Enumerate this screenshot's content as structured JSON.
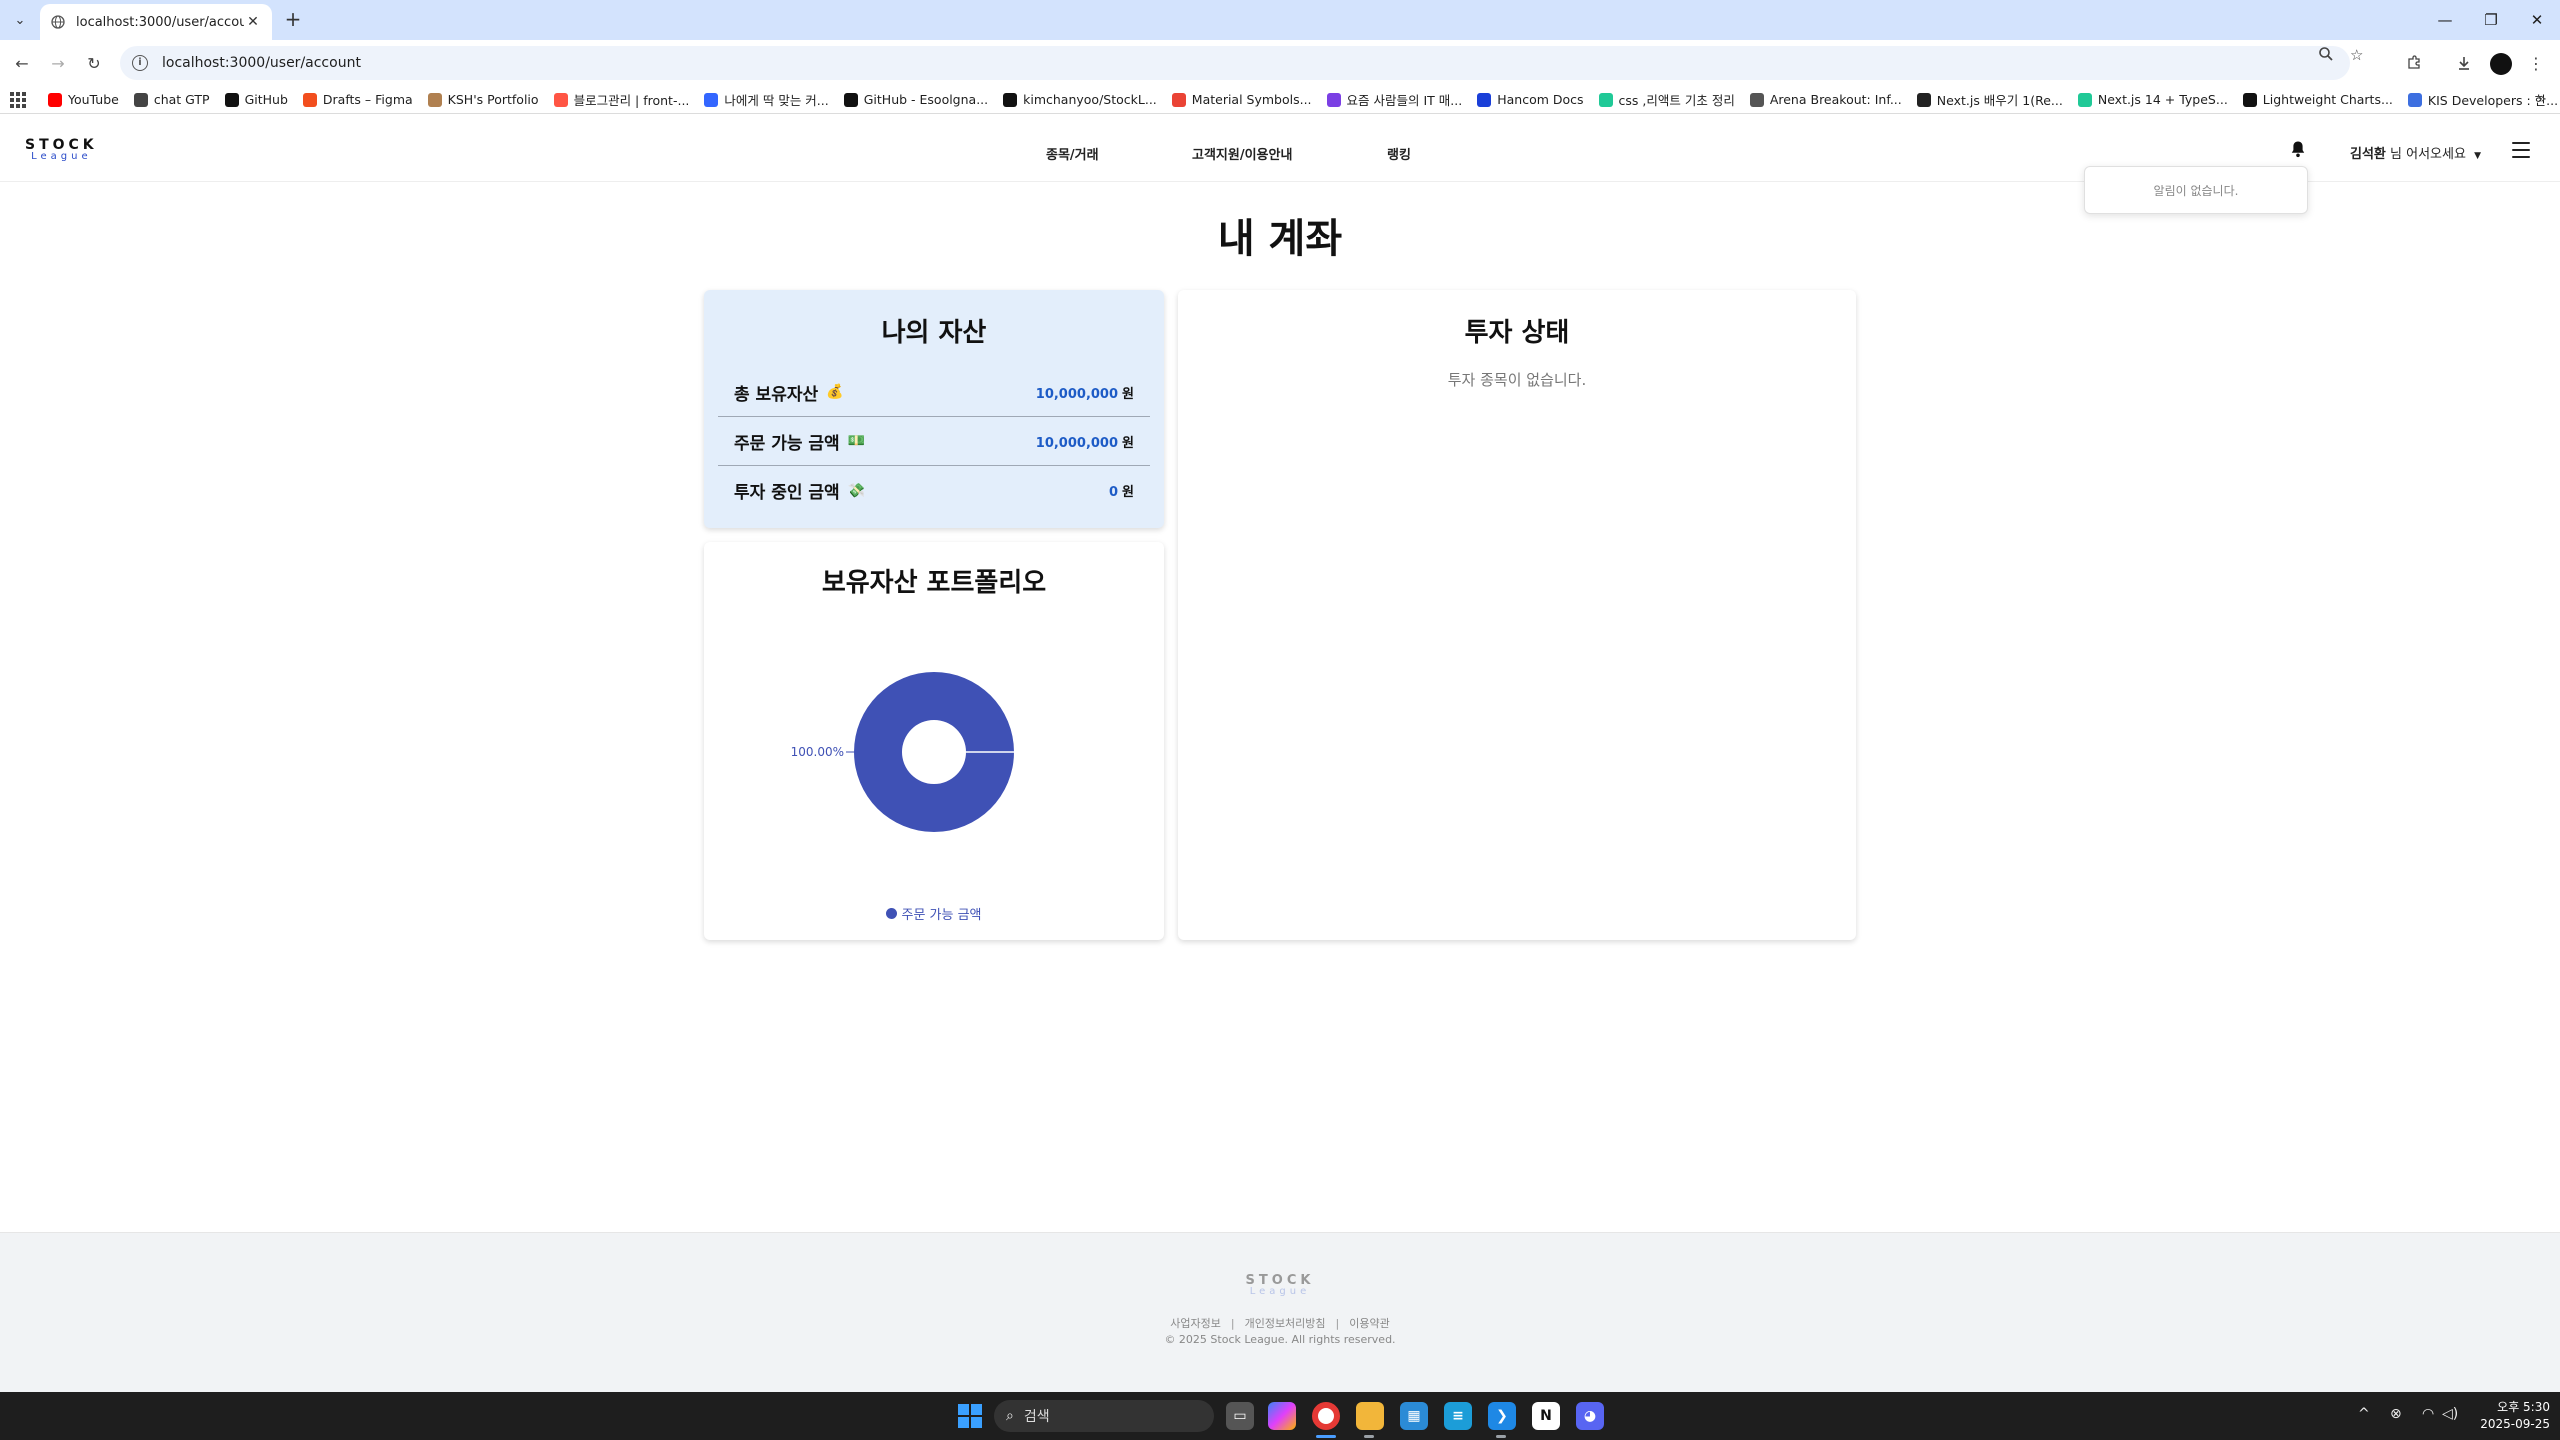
{
  "browser": {
    "tab_title": "localhost:3000/user/account",
    "url": "localhost:3000/user/account",
    "bookmarks": [
      {
        "label": "YouTube",
        "icon": "youtube-icon",
        "color": "#ff0000"
      },
      {
        "label": "chat GTP",
        "icon": "openai-icon",
        "color": "#444444"
      },
      {
        "label": "GitHub",
        "icon": "github-icon",
        "color": "#111111"
      },
      {
        "label": "Drafts – Figma",
        "icon": "figma-icon",
        "color": "#f24e1e"
      },
      {
        "label": "KSH's Portfolio",
        "icon": "portfolio-icon",
        "color": "#b08050"
      },
      {
        "label": "블로그관리 | front-...",
        "icon": "tistory-icon",
        "color": "#ff5544"
      },
      {
        "label": "나에게 딱 맞는 커...",
        "icon": "s-icon",
        "color": "#3366ff"
      },
      {
        "label": "GitHub - Esoolgna...",
        "icon": "github-icon",
        "color": "#111111"
      },
      {
        "label": "kimchanyoo/StockL...",
        "icon": "github-icon",
        "color": "#111111"
      },
      {
        "label": "Material Symbols...",
        "icon": "google-fonts-icon",
        "color": "#ea4335"
      },
      {
        "label": "요즘 사람들의 IT 매...",
        "icon": "yozm-icon",
        "color": "#7b3fe4"
      },
      {
        "label": "Hancom Docs",
        "icon": "hancom-icon",
        "color": "#1a3fd8"
      },
      {
        "label": "css ,리액트 기초 정리",
        "icon": "velog-icon",
        "color": "#20c997"
      },
      {
        "label": "Arena Breakout: Inf...",
        "icon": "game-icon",
        "color": "#555555"
      },
      {
        "label": "Next.js 배우기 1(Re...",
        "icon": "nextjs-icon",
        "color": "#222222"
      },
      {
        "label": "Next.js 14 + TypeS...",
        "icon": "velog-icon",
        "color": "#20c997"
      },
      {
        "label": "Lightweight Charts...",
        "icon": "tradingview-icon",
        "color": "#111111"
      },
      {
        "label": "KIS Developers : 한...",
        "icon": "kis-icon",
        "color": "#3d6fe0"
      }
    ]
  },
  "header": {
    "logo_stock": "STOCK",
    "logo_league": "League",
    "nav": [
      "종목/거래",
      "고객지원/이용안내",
      "랭킹"
    ],
    "user_name": "김석환",
    "user_suffix": " 님 어서오세요",
    "notification": "알림이 없습니다."
  },
  "main": {
    "title": "내 계좌",
    "assets": {
      "title": "나의 자산",
      "rows": [
        {
          "label": "총 보유자산",
          "emoji": "💰",
          "value": "10,000,000",
          "unit": "원"
        },
        {
          "label": "주문 가능 금액",
          "emoji": "💵",
          "value": "10,000,000",
          "unit": "원"
        },
        {
          "label": "투자 중인 금액",
          "emoji": "💸",
          "value": "0",
          "unit": "원"
        }
      ]
    },
    "status": {
      "title": "투자 상태",
      "empty": "투자 종목이 없습니다."
    },
    "portfolio": {
      "title": "보유자산 포트폴리오",
      "slice_label": "100.00%",
      "legend": "주문 가능 금액",
      "color": "#3f51b5"
    }
  },
  "chart_data": {
    "type": "pie",
    "title": "보유자산 포트폴리오",
    "categories": [
      "주문 가능 금액"
    ],
    "values": [
      100.0
    ],
    "labels": [
      "100.00%"
    ],
    "colors": [
      "#3f51b5"
    ],
    "legend": "bottom"
  },
  "footer": {
    "logo_stock": "STOCK",
    "logo_league": "League",
    "links": [
      "사업자정보",
      "개인정보처리방침",
      "이용약관"
    ],
    "copyright": "© 2025 Stock League. All rights reserved."
  },
  "taskbar": {
    "search_placeholder": "검색",
    "time": "오후 5:30",
    "date": "2025-09-25"
  }
}
